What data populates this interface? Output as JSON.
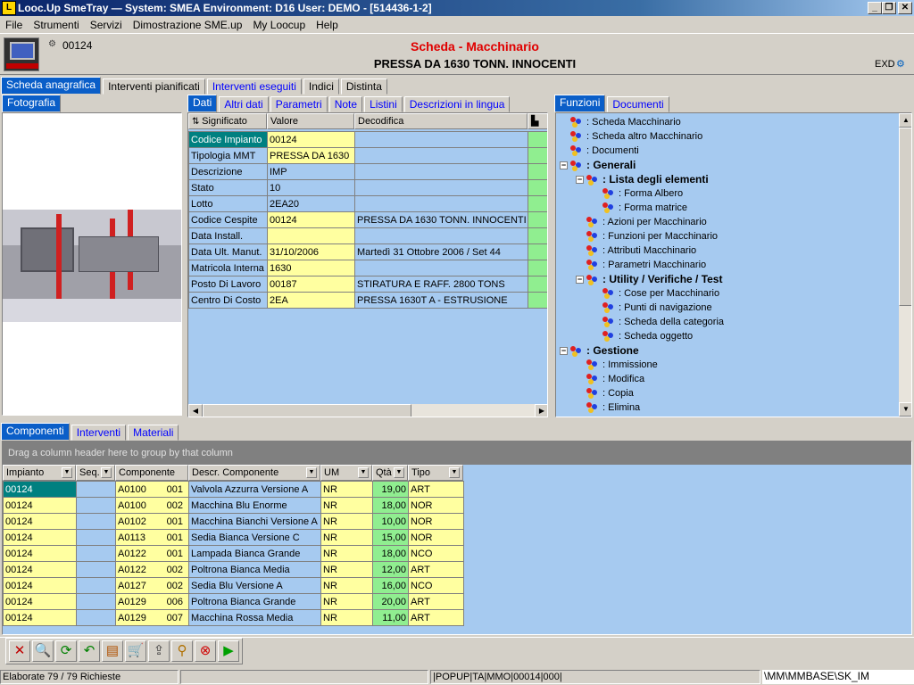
{
  "window": {
    "title": "Looc.Up SmeTray — System: SMEA Environment: D16 User: DEMO - [514436-1-2]",
    "icon_glyph": "L"
  },
  "menu": [
    "File",
    "Strumenti",
    "Servizi",
    "Dimostrazione SME.up",
    "My Loocup",
    "Help"
  ],
  "header": {
    "code": "00124",
    "title": "Scheda - Macchinario",
    "subtitle": "PRESSA DA 1630 TONN. INNOCENTI",
    "exd": "EXD"
  },
  "main_tabs": [
    {
      "label": "Scheda anagrafica",
      "active": true
    },
    {
      "label": "Interventi pianificati"
    },
    {
      "label": "Interventi eseguiti",
      "blue": true
    },
    {
      "label": "Indici"
    },
    {
      "label": "Distinta"
    }
  ],
  "photo_tab": "Fotografia",
  "data_tabs": [
    {
      "label": "Dati",
      "active": true
    },
    {
      "label": "Altri dati",
      "blue": true
    },
    {
      "label": "Parametri",
      "blue": true
    },
    {
      "label": "Note",
      "blue": true
    },
    {
      "label": "Listini",
      "blue": true
    },
    {
      "label": "Descrizioni in lingua",
      "blue": true
    }
  ],
  "data_columns": [
    "Significato",
    "Valore",
    "Decodifica"
  ],
  "data_rows": [
    {
      "label": "Codice Impianto",
      "value": "00124",
      "decode": "",
      "selected": true
    },
    {
      "label": "Tipologia MMT",
      "value": "PRESSA DA 1630",
      "decode": "",
      "yellow": true
    },
    {
      "label": "Descrizione",
      "value": "IMP",
      "decode": ""
    },
    {
      "label": "Stato",
      "value": "10",
      "decode": ""
    },
    {
      "label": "Lotto",
      "value": "2EA20",
      "decode": ""
    },
    {
      "label": "Codice Cespite",
      "value": "00124",
      "decode": "PRESSA DA 1630 TONN. INNOCENTI",
      "yellow": true
    },
    {
      "label": "Data Install.",
      "value": "",
      "decode": "",
      "yellow": true
    },
    {
      "label": "Data Ult. Manut.",
      "value": "31/10/2006",
      "decode": "Martedì 31 Ottobre 2006 / Set 44",
      "yellow": true
    },
    {
      "label": "Matricola Interna",
      "value": "1630",
      "decode": "",
      "yellow": true
    },
    {
      "label": "Posto Di Lavoro",
      "value": "00187",
      "decode": "STIRATURA E RAFF. 2800 TONS",
      "yellow": true
    },
    {
      "label": "Centro Di Costo",
      "value": "2EA",
      "decode": "PRESSA 1630T A - ESTRUSIONE",
      "yellow": true
    }
  ],
  "func_tabs": [
    {
      "label": "Funzioni",
      "active": true
    },
    {
      "label": "Documenti",
      "blue": true
    }
  ],
  "tree": [
    {
      "text": ": Scheda Macchinario",
      "level": 0
    },
    {
      "text": ": Scheda altro Macchinario",
      "level": 0
    },
    {
      "text": ": Documenti",
      "level": 0
    },
    {
      "text": ": Generali",
      "level": 0,
      "bold": true,
      "expander": "−"
    },
    {
      "text": ": Lista degli elementi",
      "level": 1,
      "bold": true,
      "expander": "−"
    },
    {
      "text": ": Forma Albero",
      "level": 2
    },
    {
      "text": ": Forma matrice",
      "level": 2
    },
    {
      "text": ": Azioni per Macchinario",
      "level": 1
    },
    {
      "text": ": Funzioni per Macchinario",
      "level": 1
    },
    {
      "text": ": Attributi Macchinario",
      "level": 1
    },
    {
      "text": ": Parametri Macchinario",
      "level": 1
    },
    {
      "text": ": Utility / Verifiche / Test",
      "level": 1,
      "bold": true,
      "expander": "−"
    },
    {
      "text": ": Cose per Macchinario",
      "level": 2
    },
    {
      "text": ": Punti di navigazione",
      "level": 2
    },
    {
      "text": ": Scheda della categoria",
      "level": 2
    },
    {
      "text": ": Scheda oggetto",
      "level": 2
    },
    {
      "text": ": Gestione",
      "level": 0,
      "bold": true,
      "expander": "−"
    },
    {
      "text": ": Immissione",
      "level": 1
    },
    {
      "text": ": Modifica",
      "level": 1
    },
    {
      "text": ": Copia",
      "level": 1
    },
    {
      "text": ": Elimina",
      "level": 1
    }
  ],
  "bottom_tabs": [
    {
      "label": "Componenti",
      "active": true
    },
    {
      "label": "Interventi",
      "blue": true
    },
    {
      "label": "Materiali",
      "blue": true
    }
  ],
  "group_hint": "Drag a column header here to group by that column",
  "comp_columns": [
    "Impianto",
    "Seq.",
    "Componente",
    "Descr. Componente",
    "UM",
    "Qtà",
    "Tipo"
  ],
  "comp_rows": [
    {
      "impianto": "00124",
      "seq": "",
      "comp": "A0100",
      "var": "001",
      "descr": "Valvola Azzurra Versione A",
      "um": "NR",
      "qta": "19,00",
      "tipo": "ART"
    },
    {
      "impianto": "00124",
      "seq": "",
      "comp": "A0100",
      "var": "002",
      "descr": "Macchina Blu Enorme",
      "um": "NR",
      "qta": "18,00",
      "tipo": "NOR"
    },
    {
      "impianto": "00124",
      "seq": "",
      "comp": "A0102",
      "var": "001",
      "descr": "Macchina Bianchi Versione A",
      "um": "NR",
      "qta": "10,00",
      "tipo": "NOR"
    },
    {
      "impianto": "00124",
      "seq": "",
      "comp": "A0113",
      "var": "001",
      "descr": "Sedia Bianca Versione C",
      "um": "NR",
      "qta": "15,00",
      "tipo": "NOR"
    },
    {
      "impianto": "00124",
      "seq": "",
      "comp": "A0122",
      "var": "001",
      "descr": "Lampada Bianca Grande",
      "um": "NR",
      "qta": "18,00",
      "tipo": "NCO"
    },
    {
      "impianto": "00124",
      "seq": "",
      "comp": "A0122",
      "var": "002",
      "descr": "Poltrona Bianca Media",
      "um": "NR",
      "qta": "12,00",
      "tipo": "ART"
    },
    {
      "impianto": "00124",
      "seq": "",
      "comp": "A0127",
      "var": "002",
      "descr": "Sedia Blu Versione A",
      "um": "NR",
      "qta": "16,00",
      "tipo": "NCO"
    },
    {
      "impianto": "00124",
      "seq": "",
      "comp": "A0129",
      "var": "006",
      "descr": "Poltrona Bianca Grande",
      "um": "NR",
      "qta": "20,00",
      "tipo": "ART"
    },
    {
      "impianto": "00124",
      "seq": "",
      "comp": "A0129",
      "var": "007",
      "descr": "Macchina Rossa Media",
      "um": "NR",
      "qta": "11,00",
      "tipo": "ART"
    }
  ],
  "toolbar": [
    {
      "name": "delete-icon",
      "glyph": "✕",
      "color": "#c00000"
    },
    {
      "name": "search-icon",
      "glyph": "🔍",
      "color": "#404040"
    },
    {
      "name": "refresh-icon",
      "glyph": "⟳",
      "color": "#008000"
    },
    {
      "name": "back-icon",
      "glyph": "↶",
      "color": "#008000"
    },
    {
      "name": "export-icon",
      "glyph": "▤",
      "color": "#b05000"
    },
    {
      "name": "cart-icon",
      "glyph": "🛒",
      "color": "#404040"
    },
    {
      "name": "upload-icon",
      "glyph": "⇪",
      "color": "#404040"
    },
    {
      "name": "zoom-icon",
      "glyph": "⚲",
      "color": "#b07000"
    },
    {
      "name": "stop-icon",
      "glyph": "⊗",
      "color": "#d00000"
    },
    {
      "name": "play-icon",
      "glyph": "▶",
      "color": "#00a000"
    }
  ],
  "status": {
    "left": "Elaborate 79 / 79 Richieste",
    "mid": "|POPUP|TA|MMO|00014|000|",
    "right": "\\MM\\MMBASE\\SK_IM"
  },
  "colors": {
    "active_tab": "#0a5ec8",
    "panel": "#a6caf0",
    "yellow": "#ffffa0",
    "green": "#90ee90"
  }
}
